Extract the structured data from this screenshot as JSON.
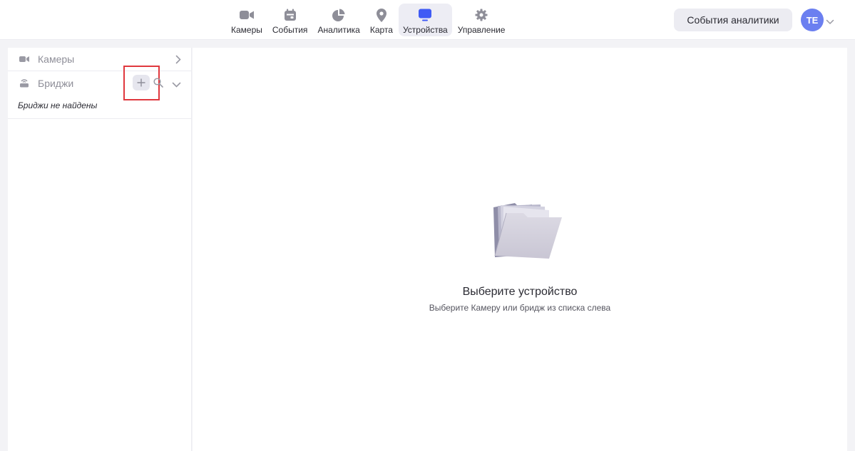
{
  "nav": {
    "items": [
      {
        "label": "Камеры",
        "icon": "video-camera-icon"
      },
      {
        "label": "События",
        "icon": "calendar-icon"
      },
      {
        "label": "Аналитика",
        "icon": "pie-chart-icon"
      },
      {
        "label": "Карта",
        "icon": "map-pin-icon"
      },
      {
        "label": "Устройства",
        "icon": "monitor-icon",
        "active": true
      },
      {
        "label": "Управление",
        "icon": "gear-icon"
      }
    ]
  },
  "header": {
    "analytics_button": "События аналитики",
    "avatar_initials": "TE"
  },
  "sidebar": {
    "cameras_label": "Камеры",
    "bridges_label": "Бриджи",
    "bridges_empty": "Бриджи не найдены"
  },
  "main": {
    "title": "Выберите устройство",
    "subtitle": "Выберите Камеру или бридж из списка слева"
  },
  "colors": {
    "accent": "#3f5bf5",
    "avatar": "#6b7ff0",
    "highlight": "#e0383e",
    "icon_gray": "#8e8e98"
  }
}
